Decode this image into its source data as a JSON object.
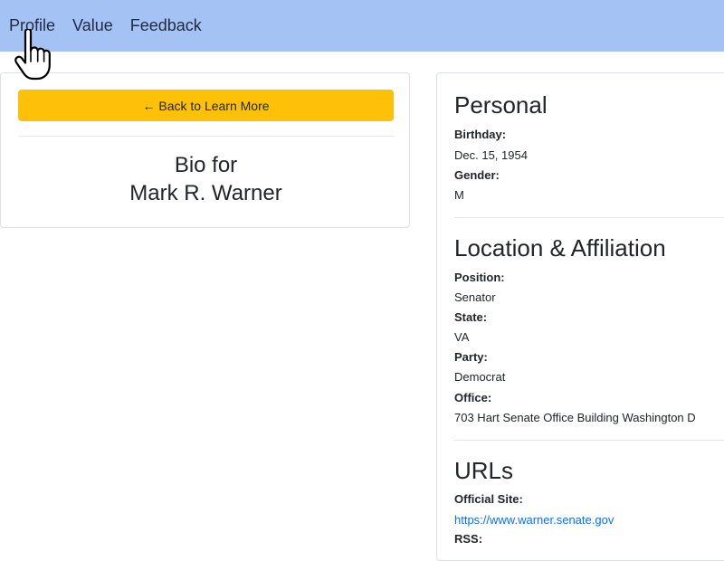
{
  "nav": {
    "items": [
      {
        "label": "Profile"
      },
      {
        "label": "Value"
      },
      {
        "label": "Feedback"
      }
    ]
  },
  "left_panel": {
    "back_button_label": "← Back to Learn More",
    "bio_line1": "Bio for",
    "bio_line2": "Mark R. Warner"
  },
  "right_panel": {
    "personal": {
      "title": "Personal",
      "birthday_label": "Birthday:",
      "birthday_value": "Dec. 15, 1954",
      "gender_label": "Gender:",
      "gender_value": "M"
    },
    "location": {
      "title": "Location & Affiliation",
      "position_label": "Position:",
      "position_value": "Senator",
      "state_label": "State:",
      "state_value": "VA",
      "party_label": "Party:",
      "party_value": "Democrat",
      "office_label": "Office:",
      "office_value": "703 Hart Senate Office Building Washington D"
    },
    "urls": {
      "title": "URLs",
      "official_label": "Official Site:",
      "official_value": "https://www.warner.senate.gov",
      "rss_label": "RSS:"
    }
  },
  "colors": {
    "navbar_bg": "#a4c2f4",
    "button_bg": "#ffc107",
    "link": "#0d6efd"
  },
  "icons": {
    "cursor": "hand-pointer-icon"
  }
}
